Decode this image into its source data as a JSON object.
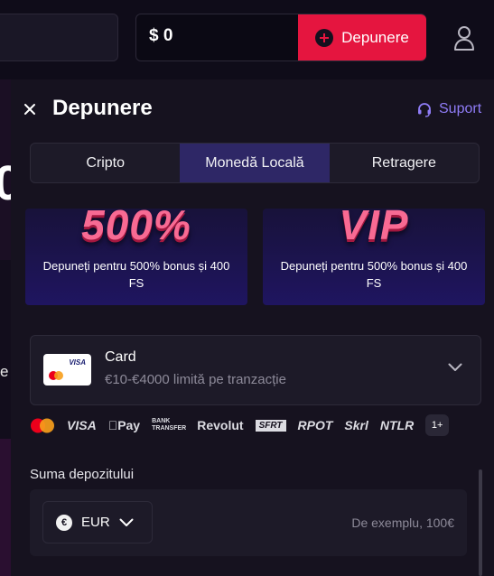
{
  "header": {
    "balance": "$ 0",
    "deposit_button": "Depunere"
  },
  "background": {
    "frag_big": "0",
    "frag_small": "e"
  },
  "panel": {
    "title": "Depunere",
    "support_label": "Suport",
    "tabs": [
      {
        "label": "Cripto",
        "active": false
      },
      {
        "label": "Monedă Locală",
        "active": true
      },
      {
        "label": "Retragere",
        "active": false
      }
    ],
    "promos": [
      {
        "big": "500%",
        "text": "Depuneți pentru 500% bonus și 400 FS"
      },
      {
        "big": "VIP",
        "text": "Depuneți pentru 500% bonus și 400 FS"
      }
    ],
    "method": {
      "title": "Card",
      "subtitle": "€10-€4000 limită pe tranzacție",
      "card_brand": "VISA"
    },
    "payment_logos": [
      "VISA",
      "Pay",
      "BANK",
      "TRANSFER",
      "Revolut",
      "SFRT",
      "RPOT",
      "Skrl",
      "NTLR"
    ],
    "more_badge": "1+",
    "amount": {
      "label": "Suma depozitului",
      "currency_symbol": "€",
      "currency": "EUR",
      "placeholder": "De exemplu, 100€"
    }
  },
  "colors": {
    "accent": "#e5153f",
    "support": "#8f7cf6",
    "active_tab": "#2e2766"
  }
}
